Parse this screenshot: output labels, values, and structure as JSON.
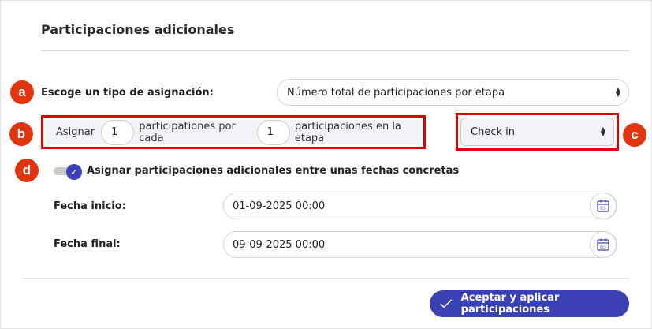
{
  "section": {
    "title": "Participaciones adicionales"
  },
  "badges": {
    "a": "a",
    "b": "b",
    "c": "c",
    "d": "d"
  },
  "assignment_type": {
    "label": "Escoge un tipo de asignación:",
    "selected": "Número total de participaciones por etapa"
  },
  "assign_row": {
    "prefix": "Asignar",
    "participations_value": "1",
    "middle": "participationes por cada",
    "stage_value": "1",
    "suffix": "participaciones en la etapa"
  },
  "checkin_select": {
    "selected": "Check in"
  },
  "date_toggle": {
    "checked": true,
    "label": "Asignar participaciones adicionales entre unas fechas concretas"
  },
  "start_date": {
    "label": "Fecha inicio:",
    "value": "01-09-2025 00:00"
  },
  "end_date": {
    "label": "Fecha final:",
    "value": "09-09-2025 00:00"
  },
  "calendar_day": "03",
  "accept_button": {
    "label": "Aceptar y aplicar participaciones"
  },
  "colors": {
    "accent": "#3a41b5",
    "badge": "#e0350f",
    "highlight_border": "#e00000"
  }
}
